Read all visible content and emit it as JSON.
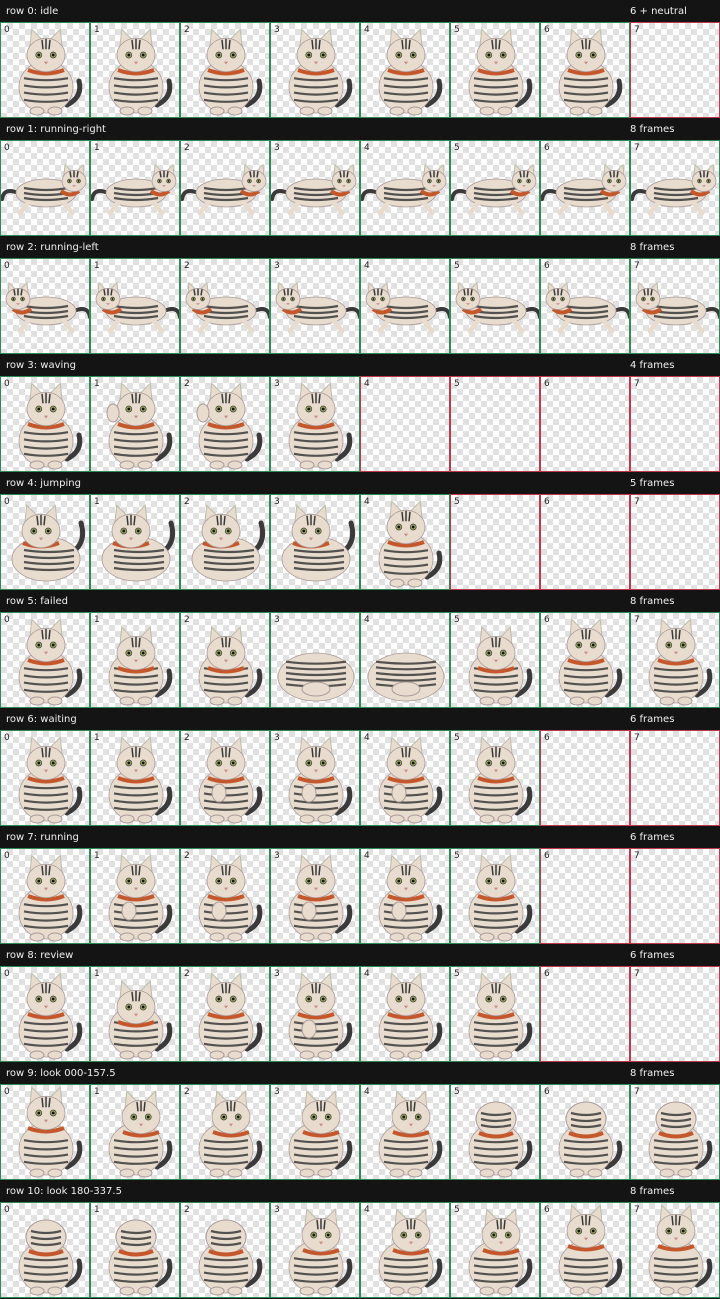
{
  "rows": [
    {
      "label": "row 0: idle",
      "count": "6 + neutral",
      "frames": [
        {
          "i": "0",
          "p": "sit"
        },
        {
          "i": "1",
          "p": "sit"
        },
        {
          "i": "2",
          "p": "sit"
        },
        {
          "i": "3",
          "p": "sit"
        },
        {
          "i": "4",
          "p": "sit"
        },
        {
          "i": "5",
          "p": "sit"
        },
        {
          "i": "6",
          "p": "sit"
        },
        {
          "i": "7",
          "p": "empty"
        }
      ]
    },
    {
      "label": "row 1: running-right",
      "count": "8 frames",
      "frames": [
        {
          "i": "0",
          "p": "run-right"
        },
        {
          "i": "1",
          "p": "run-right"
        },
        {
          "i": "2",
          "p": "run-right"
        },
        {
          "i": "3",
          "p": "run-right"
        },
        {
          "i": "4",
          "p": "run-right"
        },
        {
          "i": "5",
          "p": "run-right"
        },
        {
          "i": "6",
          "p": "run-right"
        },
        {
          "i": "7",
          "p": "run-right"
        }
      ]
    },
    {
      "label": "row 2: running-left",
      "count": "8 frames",
      "frames": [
        {
          "i": "0",
          "p": "run-left"
        },
        {
          "i": "1",
          "p": "run-left"
        },
        {
          "i": "2",
          "p": "run-left"
        },
        {
          "i": "3",
          "p": "run-left"
        },
        {
          "i": "4",
          "p": "run-left"
        },
        {
          "i": "5",
          "p": "run-left"
        },
        {
          "i": "6",
          "p": "run-left"
        },
        {
          "i": "7",
          "p": "run-left"
        }
      ]
    },
    {
      "label": "row 3: waving",
      "count": "4 frames",
      "frames": [
        {
          "i": "0",
          "p": "sit"
        },
        {
          "i": "1",
          "p": "wave"
        },
        {
          "i": "2",
          "p": "wave"
        },
        {
          "i": "3",
          "p": "sit"
        },
        {
          "i": "4",
          "p": "empty"
        },
        {
          "i": "5",
          "p": "empty"
        },
        {
          "i": "6",
          "p": "empty"
        },
        {
          "i": "7",
          "p": "empty"
        }
      ]
    },
    {
      "label": "row 4: jumping",
      "count": "5 frames",
      "frames": [
        {
          "i": "0",
          "p": "crouch"
        },
        {
          "i": "1",
          "p": "crouch"
        },
        {
          "i": "2",
          "p": "crouch"
        },
        {
          "i": "3",
          "p": "crouch"
        },
        {
          "i": "4",
          "p": "sit"
        },
        {
          "i": "5",
          "p": "empty"
        },
        {
          "i": "6",
          "p": "empty"
        },
        {
          "i": "7",
          "p": "empty"
        }
      ]
    },
    {
      "label": "row 5: failed",
      "count": "8 frames",
      "frames": [
        {
          "i": "0",
          "p": "sit"
        },
        {
          "i": "1",
          "p": "bow"
        },
        {
          "i": "2",
          "p": "bow"
        },
        {
          "i": "3",
          "p": "loaf"
        },
        {
          "i": "4",
          "p": "loaf"
        },
        {
          "i": "5",
          "p": "bow"
        },
        {
          "i": "6",
          "p": "sit"
        },
        {
          "i": "7",
          "p": "sit"
        }
      ]
    },
    {
      "label": "row 6: waiting",
      "count": "6 frames",
      "frames": [
        {
          "i": "0",
          "p": "sit"
        },
        {
          "i": "1",
          "p": "sit"
        },
        {
          "i": "2",
          "p": "paw"
        },
        {
          "i": "3",
          "p": "paw"
        },
        {
          "i": "4",
          "p": "paw"
        },
        {
          "i": "5",
          "p": "sit"
        },
        {
          "i": "6",
          "p": "empty"
        },
        {
          "i": "7",
          "p": "empty"
        }
      ]
    },
    {
      "label": "row 7: running",
      "count": "6 frames",
      "frames": [
        {
          "i": "0",
          "p": "sit"
        },
        {
          "i": "1",
          "p": "paw"
        },
        {
          "i": "2",
          "p": "paw"
        },
        {
          "i": "3",
          "p": "paw"
        },
        {
          "i": "4",
          "p": "paw"
        },
        {
          "i": "5",
          "p": "sit"
        },
        {
          "i": "6",
          "p": "empty"
        },
        {
          "i": "7",
          "p": "empty"
        }
      ]
    },
    {
      "label": "row 8: review",
      "count": "6 frames",
      "frames": [
        {
          "i": "0",
          "p": "sit"
        },
        {
          "i": "1",
          "p": "bow"
        },
        {
          "i": "2",
          "p": "sit"
        },
        {
          "i": "3",
          "p": "paw"
        },
        {
          "i": "4",
          "p": "sit"
        },
        {
          "i": "5",
          "p": "sit"
        },
        {
          "i": "6",
          "p": "empty"
        },
        {
          "i": "7",
          "p": "empty"
        }
      ]
    },
    {
      "label": "row 9: look 000-157.5",
      "count": "8 frames",
      "frames": [
        {
          "i": "0",
          "p": "look-up"
        },
        {
          "i": "1",
          "p": "look-side"
        },
        {
          "i": "2",
          "p": "look-side"
        },
        {
          "i": "3",
          "p": "look-side"
        },
        {
          "i": "4",
          "p": "look-side"
        },
        {
          "i": "5",
          "p": "look-back"
        },
        {
          "i": "6",
          "p": "look-back"
        },
        {
          "i": "7",
          "p": "look-back"
        }
      ]
    },
    {
      "label": "row 10: look 180-337.5",
      "count": "8 frames",
      "frames": [
        {
          "i": "0",
          "p": "look-back"
        },
        {
          "i": "1",
          "p": "look-back"
        },
        {
          "i": "2",
          "p": "look-back"
        },
        {
          "i": "3",
          "p": "look-side"
        },
        {
          "i": "4",
          "p": "look-side"
        },
        {
          "i": "5",
          "p": "look-side"
        },
        {
          "i": "6",
          "p": "look-up"
        },
        {
          "i": "7",
          "p": "look-up"
        }
      ]
    }
  ],
  "colors": {
    "header_bg": "#141414",
    "header_text": "#f0f0f0",
    "used_border": "#2e8b57",
    "empty_border": "#c0394b",
    "fur": "#e8dcce",
    "stripe": "#3a3a3a",
    "collar": "#c4582c",
    "eye": "#9aa35e"
  }
}
